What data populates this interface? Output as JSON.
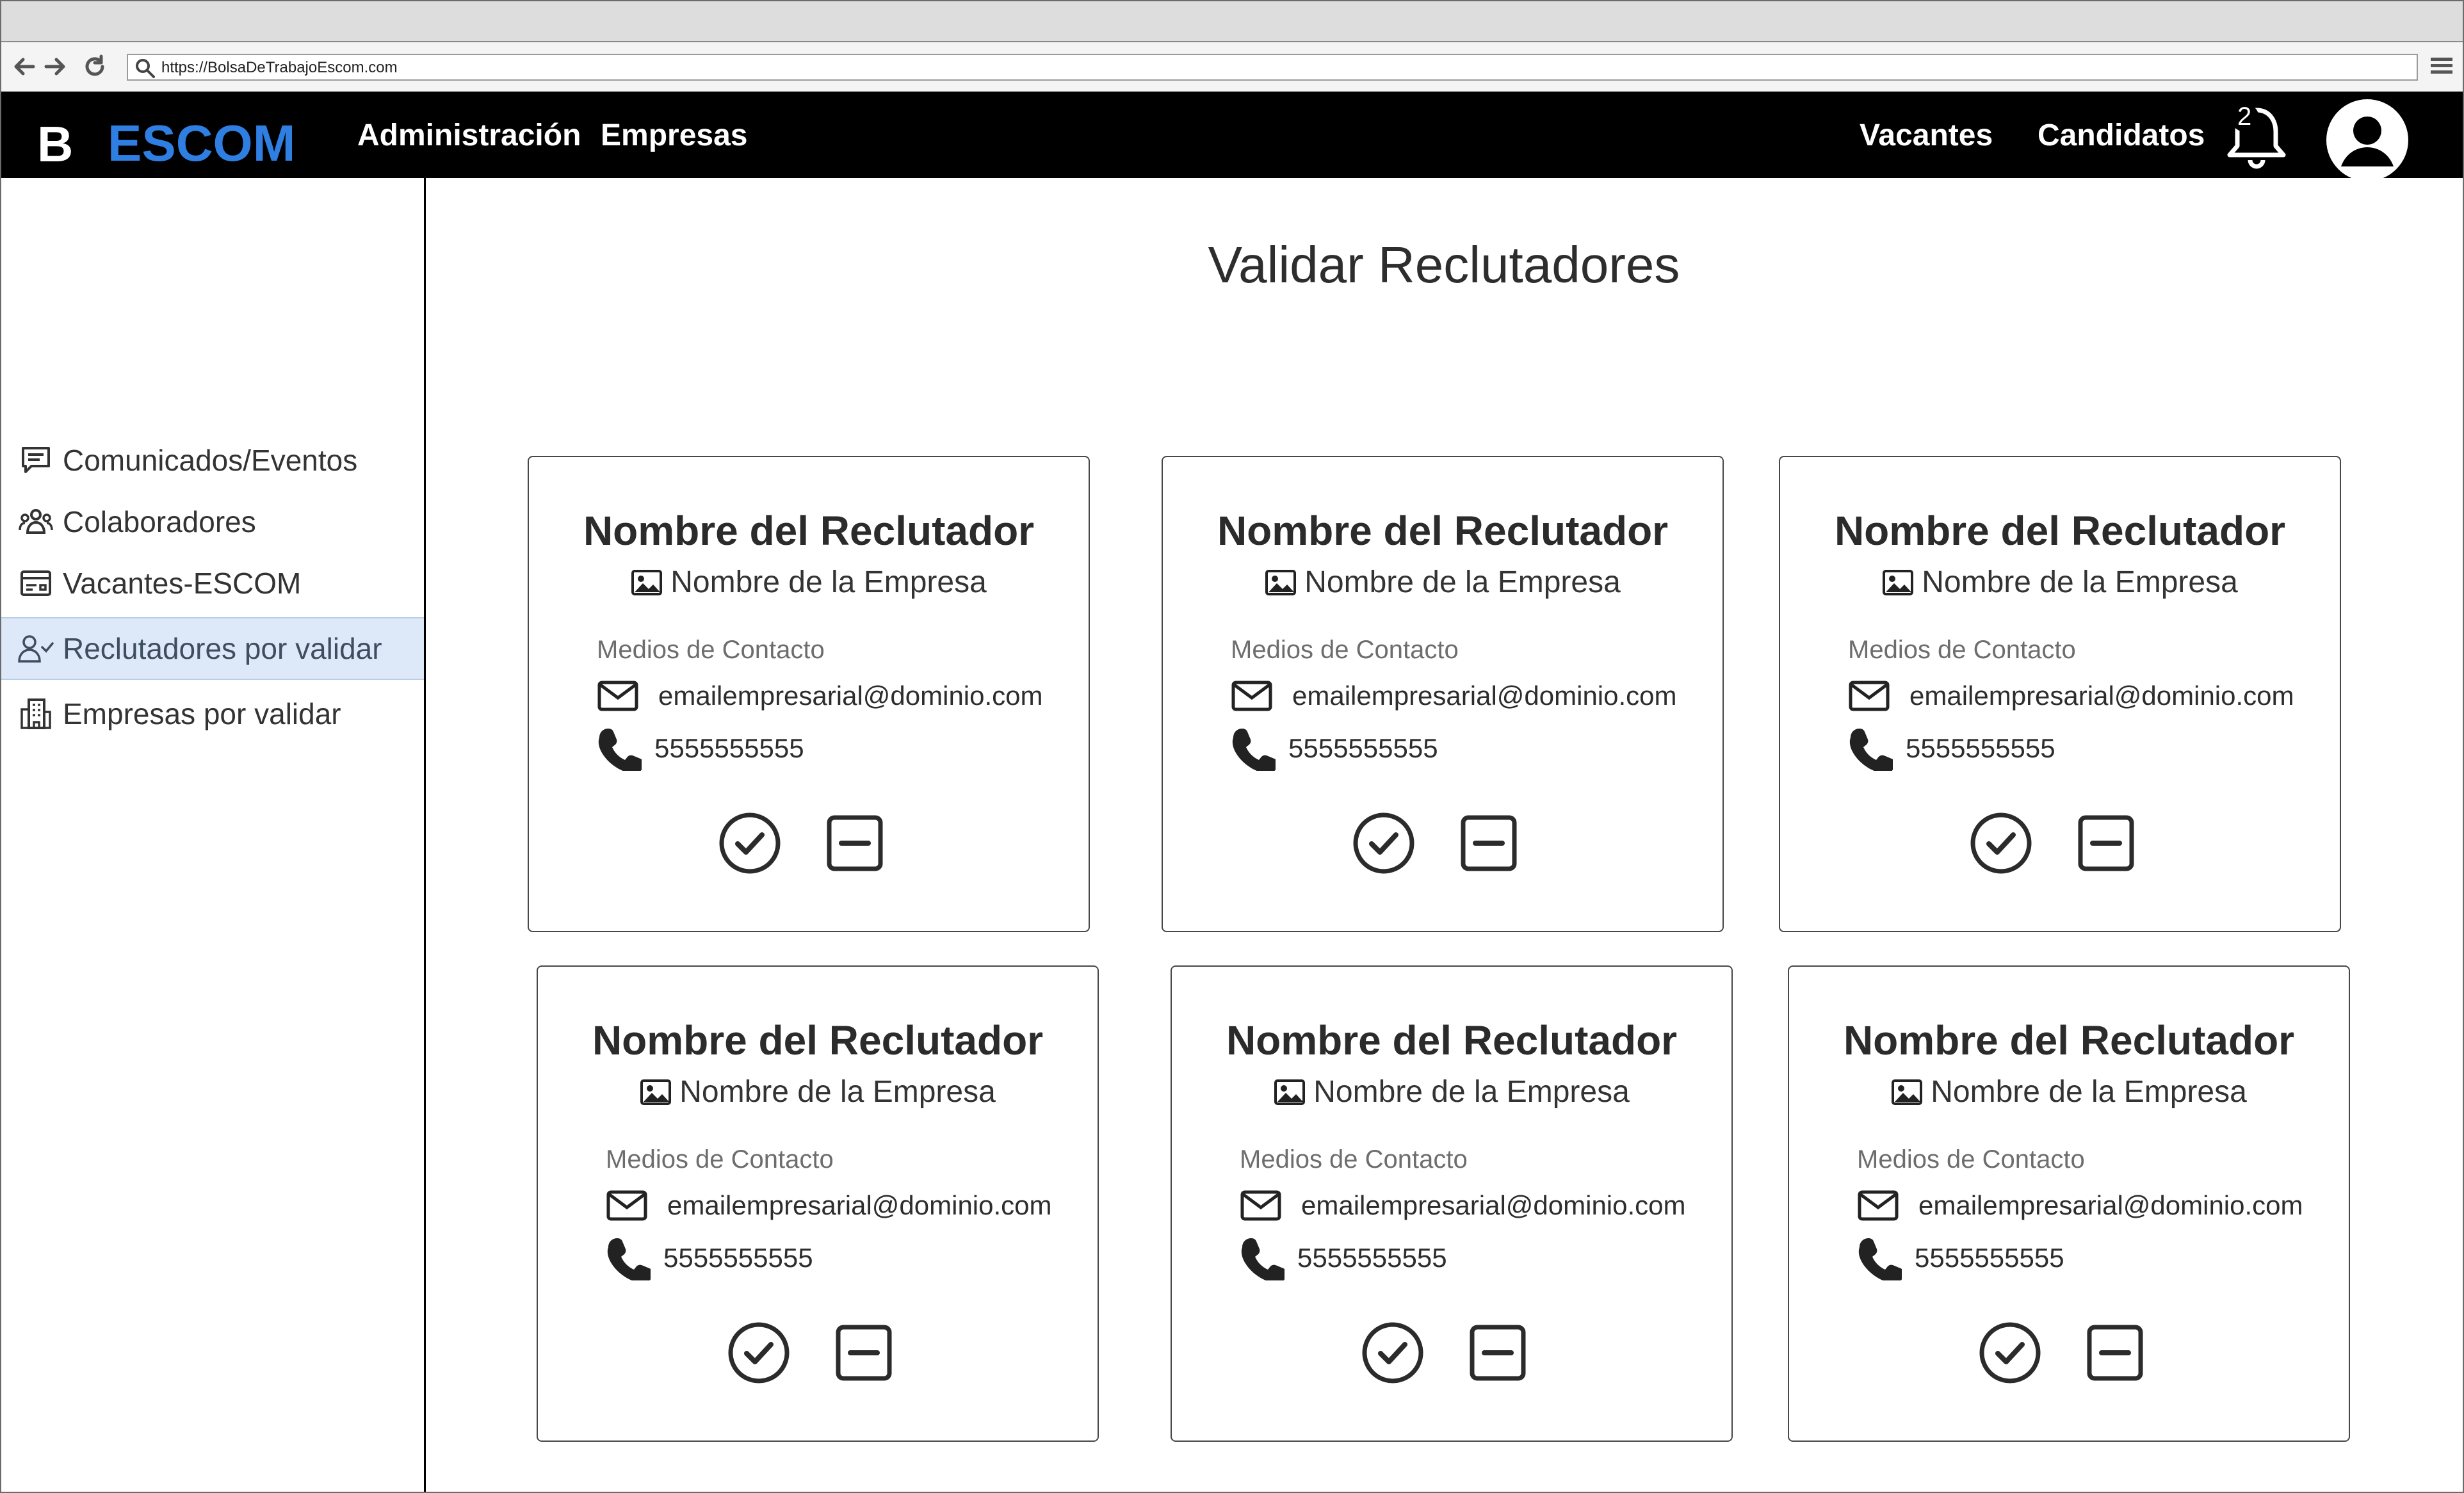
{
  "browser": {
    "url": "https://BolsaDeTrabajoEscom.com",
    "icons": [
      "back-arrow-icon",
      "forward-arrow-icon",
      "reload-icon",
      "search-icon",
      "hamburger-menu-icon"
    ]
  },
  "header": {
    "brand_letter": "B",
    "brand_name": "ESCOM",
    "brand_color": "#2f7fe3",
    "nav_left": [
      "Administración",
      "Empresas"
    ],
    "nav_right": [
      "Vacantes",
      "Candidatos"
    ],
    "notification_count": "2"
  },
  "sidebar": {
    "items": [
      {
        "label": "Comunicados/Eventos",
        "icon": "chat-icon",
        "active": false
      },
      {
        "label": "Colaboradores",
        "icon": "people-icon",
        "active": false
      },
      {
        "label": "Vacantes-ESCOM",
        "icon": "card-icon",
        "active": false
      },
      {
        "label": "Reclutadores por validar",
        "icon": "user-check-icon",
        "active": true
      },
      {
        "label": "Empresas por validar",
        "icon": "building-icon",
        "active": false
      }
    ],
    "active_bg": "#dde9f8"
  },
  "main": {
    "title": "Validar Reclutadores",
    "cards": [
      {
        "name": "Nombre del Reclutador",
        "company": "Nombre de la Empresa",
        "contact_label": "Medios de Contacto",
        "email": "emailempresarial@dominio.com",
        "phone": "5555555555"
      },
      {
        "name": "Nombre del Reclutador",
        "company": "Nombre de la Empresa",
        "contact_label": "Medios de Contacto",
        "email": "emailempresarial@dominio.com",
        "phone": "5555555555"
      },
      {
        "name": "Nombre del Reclutador",
        "company": "Nombre de la Empresa",
        "contact_label": "Medios de Contacto",
        "email": "emailempresarial@dominio.com",
        "phone": "5555555555"
      },
      {
        "name": "Nombre del Reclutador",
        "company": "Nombre de la Empresa",
        "contact_label": "Medios de Contacto",
        "email": "emailempresarial@dominio.com",
        "phone": "5555555555"
      },
      {
        "name": "Nombre del Reclutador",
        "company": "Nombre de la Empresa",
        "contact_label": "Medios de Contacto",
        "email": "emailempresarial@dominio.com",
        "phone": "5555555555"
      },
      {
        "name": "Nombre del Reclutador",
        "company": "Nombre de la Empresa",
        "contact_label": "Medios de Contacto",
        "email": "emailempresarial@dominio.com",
        "phone": "5555555555"
      }
    ]
  }
}
